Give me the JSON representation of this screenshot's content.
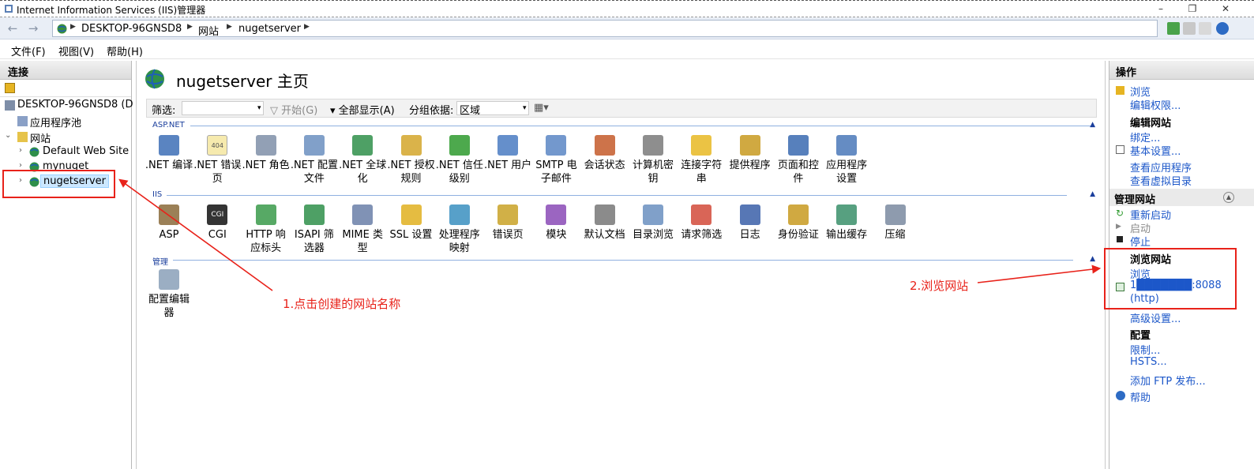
{
  "window": {
    "title": "Internet Information Services (IIS)管理器",
    "min": "–",
    "max": "❐",
    "close": "✕"
  },
  "address": {
    "back": "←",
    "forward": "→",
    "crumbs": [
      "DESKTOP-96GNSD8",
      "网站",
      "nugetserver"
    ]
  },
  "menu": [
    "文件(F)",
    "视图(V)",
    "帮助(H)"
  ],
  "connections": {
    "header": "连接",
    "tree": [
      {
        "label": "DESKTOP-96GNSD8 (D",
        "expander": "⌄"
      },
      {
        "label": "应用程序池",
        "expander": ""
      },
      {
        "label": "网站",
        "expander": "⌄"
      },
      {
        "label": "Default Web Site",
        "expander": "›"
      },
      {
        "label": "mynuget",
        "expander": "›"
      },
      {
        "label": "nugetserver",
        "expander": "›"
      }
    ]
  },
  "center": {
    "title": "nugetserver 主页",
    "filter": {
      "label": "筛选:",
      "start": "开始(G)",
      "show_all": "全部显示(A)",
      "group_by": "分组依据:",
      "group_value": "区域"
    },
    "sections": [
      {
        "name": "ASP.NET",
        "items": [
          ".NET 编译",
          ".NET 错误页",
          ".NET 角色",
          ".NET 配置文件",
          ".NET 全球化",
          ".NET 授权规则",
          ".NET 信任级别",
          ".NET 用户",
          "SMTP 电子邮件",
          "会话状态",
          "计算机密钥",
          "连接字符串",
          "提供程序",
          "页面和控件",
          "应用程序设置"
        ]
      },
      {
        "name": "IIS",
        "items": [
          "ASP",
          "CGI",
          "HTTP 响应标头",
          "ISAPI 筛选器",
          "MIME 类型",
          "SSL 设置",
          "处理程序映射",
          "错误页",
          "模块",
          "默认文档",
          "目录浏览",
          "请求筛选",
          "日志",
          "身份验证",
          "输出缓存",
          "压缩"
        ]
      },
      {
        "name": "管理",
        "items": [
          "配置编辑器"
        ]
      }
    ],
    "cgi_badge": "CGI",
    "err_badge": "404"
  },
  "actions": {
    "header": "操作",
    "browse": "浏览",
    "edit_perms": "编辑权限...",
    "edit_site_h": "编辑网站",
    "bind": "绑定...",
    "basic": "基本设置...",
    "view_apps": "查看应用程序",
    "view_vdirs": "查看虚拟目录",
    "manage_h": "管理网站",
    "restart": "重新启动",
    "start": "启动",
    "stop": "停止",
    "browse_h": "浏览网站",
    "browse2": "浏览",
    "url_line1": "1███████:8088",
    "url_line2": "(http)",
    "advanced": "高级设置...",
    "config_h": "配置",
    "limits": "限制...",
    "hsts": "HSTS...",
    "add_ftp": "添加 FTP 发布...",
    "help": "帮助"
  },
  "annotations": {
    "step1": "1.点击创建的网站名称",
    "step2": "2.浏览网站"
  },
  "colors": {
    "link": "#1c57c9",
    "accent_red": "#e8221a",
    "section_blue": "#1a3e9c"
  }
}
